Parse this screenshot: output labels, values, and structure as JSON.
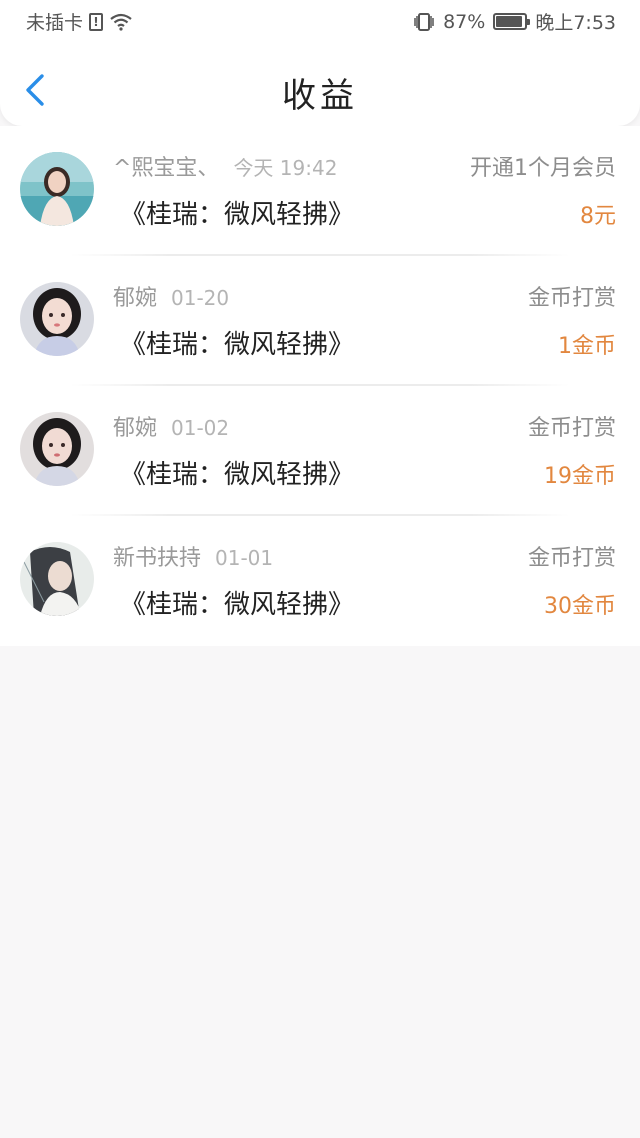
{
  "status_bar": {
    "carrier": "未插卡",
    "battery": "87%",
    "battery_level": 0.87,
    "time": "晚上7:53"
  },
  "header": {
    "title": "收益"
  },
  "items": [
    {
      "user": "^熙宝宝、",
      "time": "今天 19:42",
      "type": "开通1个月会员",
      "book": "《桂瑞：微风轻拂》",
      "amount": "8元"
    },
    {
      "user": "郁婉",
      "time": "01-20",
      "type": "金币打赏",
      "book": "《桂瑞：微风轻拂》",
      "amount": "1金币"
    },
    {
      "user": "郁婉",
      "time": "01-02",
      "type": "金币打赏",
      "book": "《桂瑞：微风轻拂》",
      "amount": "19金币"
    },
    {
      "user": "新书扶持",
      "time": "01-01",
      "type": "金币打赏",
      "book": "《桂瑞：微风轻拂》",
      "amount": "30金币"
    }
  ],
  "colors": {
    "accent": "#2a8ee8",
    "amount": "#e2873f",
    "background": "#f8f7f8"
  }
}
